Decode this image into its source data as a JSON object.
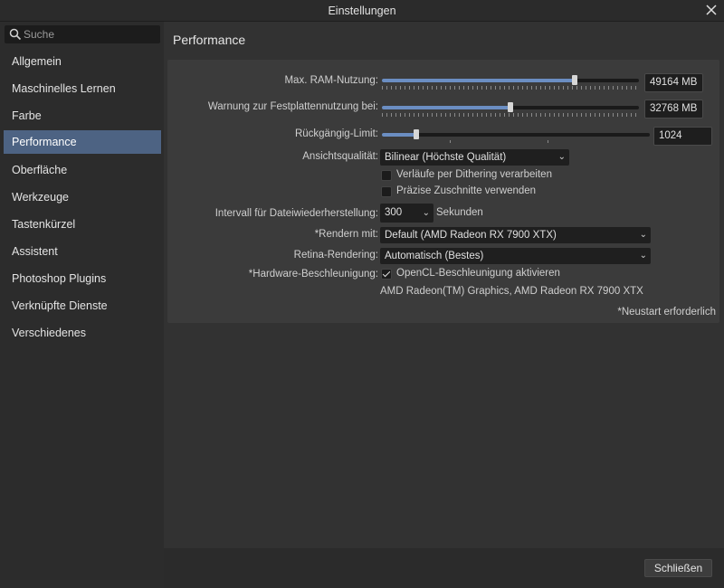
{
  "window": {
    "title": "Einstellungen"
  },
  "search": {
    "placeholder": "Suche"
  },
  "sidebar": {
    "items": [
      {
        "label": "Allgemein"
      },
      {
        "label": "Maschinelles Lernen"
      },
      {
        "label": "Farbe"
      },
      {
        "label": "Performance",
        "active": true
      },
      {
        "label": "Oberfläche"
      },
      {
        "label": "Werkzeuge"
      },
      {
        "label": "Tastenkürzel"
      },
      {
        "label": "Assistent"
      },
      {
        "label": "Photoshop Plugins"
      },
      {
        "label": "Verknüpfte Dienste"
      },
      {
        "label": "Verschiedenes"
      }
    ]
  },
  "page": {
    "title": "Performance"
  },
  "settings": {
    "ram": {
      "label": "Max. RAM-Nutzung:",
      "value": "49164 MB",
      "level": 0.75
    },
    "disk_warning": {
      "label": "Warnung zur Festplattennutzung bei:",
      "value": "32768 MB",
      "level": 0.5
    },
    "undo": {
      "label": "Rückgängig-Limit:",
      "value": "1024",
      "level": 0.13
    },
    "view_quality": {
      "label": "Ansichtsqualität:",
      "value": "Bilinear (Höchste Qualität)"
    },
    "dithering": {
      "label": "Verläufe per Dithering verarbeiten",
      "checked": false
    },
    "precise_clip": {
      "label": "Präzise Zuschnitte verwenden",
      "checked": false
    },
    "recovery_interval": {
      "label": "Intervall für Dateiwiederherstellung:",
      "value": "300",
      "unit": "Sekunden"
    },
    "render_with": {
      "label": "*Rendern mit:",
      "value": "Default (AMD Radeon RX 7900 XTX)"
    },
    "retina": {
      "label": "Retina-Rendering:",
      "value": "Automatisch (Bestes)"
    },
    "hw_accel": {
      "label": "*Hardware-Beschleunigung:",
      "option": "OpenCL-Beschleunigung aktivieren",
      "checked": true,
      "devices": "AMD Radeon(TM) Graphics, AMD Radeon RX 7900 XTX"
    },
    "restart_note": "*Neustart erforderlich"
  },
  "footer": {
    "close_label": "Schließen"
  }
}
